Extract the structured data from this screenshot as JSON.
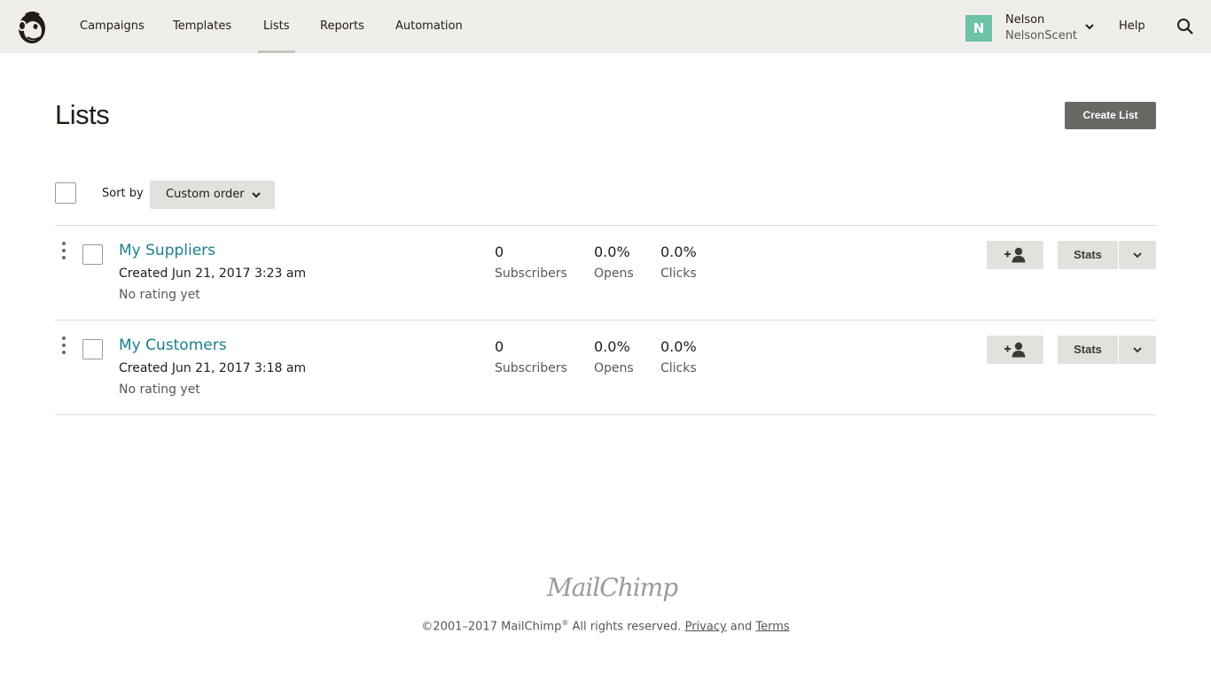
{
  "nav": {
    "items": [
      {
        "label": "Campaigns",
        "active": false
      },
      {
        "label": "Templates",
        "active": false
      },
      {
        "label": "Lists",
        "active": true
      },
      {
        "label": "Reports",
        "active": false
      },
      {
        "label": "Automation",
        "active": false
      }
    ],
    "account": {
      "initial": "N",
      "name": "Nelson",
      "org": "NelsonScent",
      "avatar_color": "#6dc2a8"
    },
    "help_label": "Help",
    "search_icon": "search-icon"
  },
  "page": {
    "title": "Lists",
    "create_button": "Create List"
  },
  "sort": {
    "label": "Sort by",
    "value": "Custom order"
  },
  "lists": [
    {
      "name": "My Suppliers",
      "created": "Created Jun 21, 2017 3:23 am",
      "rating": "No rating yet",
      "subscribers_value": "0",
      "subscribers_label": "Subscribers",
      "opens_value": "0.0%",
      "opens_label": "Opens",
      "clicks_value": "0.0%",
      "clicks_label": "Clicks",
      "stats_label": "Stats"
    },
    {
      "name": "My Customers",
      "created": "Created Jun 21, 2017 3:18 am",
      "rating": "No rating yet",
      "subscribers_value": "0",
      "subscribers_label": "Subscribers",
      "opens_value": "0.0%",
      "opens_label": "Opens",
      "clicks_value": "0.0%",
      "clicks_label": "Clicks",
      "stats_label": "Stats"
    }
  ],
  "footer": {
    "brand": "MailChimp",
    "copyright": "©2001–2017 MailChimp",
    "registered": "®",
    "rights": " All rights reserved. ",
    "privacy": "Privacy",
    "and": " and ",
    "terms": "Terms"
  },
  "colors": {
    "nav_bg": "#efeeea",
    "link": "#1b7f8c",
    "primary_button": "#6a6864",
    "secondary_button": "#e2e1dd"
  }
}
